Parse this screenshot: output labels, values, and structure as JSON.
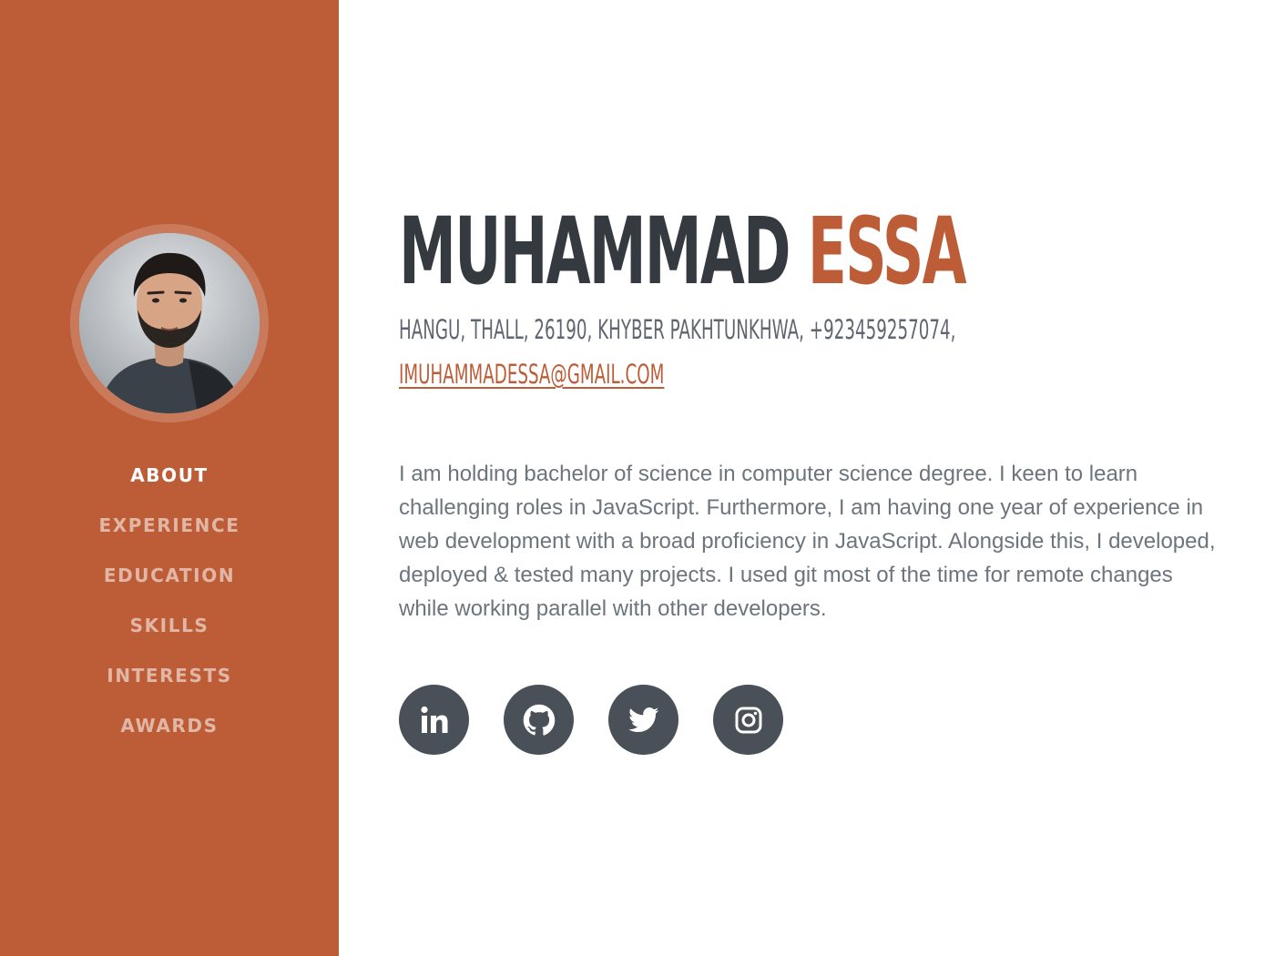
{
  "profile": {
    "first_name": "MUHAMMAD",
    "last_name": "ESSA",
    "contact_line": "HANGU, THALL, 26190, KHYBER PAKHTUNKHWA, +923459257074,",
    "email": "IMUHAMMADESSA@GMAIL.COM",
    "about": "I am holding bachelor of science in computer science degree. I keen to learn challenging roles in JavaScript. Furthermore, I am having one year of experience in web development with a broad proficiency in JavaScript. Alongside this, I developed, deployed & tested many projects. I used git most of the time for remote changes while working parallel with other developers."
  },
  "nav": {
    "items": [
      {
        "label": "ABOUT",
        "active": true
      },
      {
        "label": "EXPERIENCE",
        "active": false
      },
      {
        "label": "EDUCATION",
        "active": false
      },
      {
        "label": "SKILLS",
        "active": false
      },
      {
        "label": "INTERESTS",
        "active": false
      },
      {
        "label": "AWARDS",
        "active": false
      }
    ]
  },
  "social": {
    "icons": [
      "linkedin-icon",
      "github-icon",
      "twitter-icon",
      "instagram-icon"
    ]
  },
  "colors": {
    "primary": "#bd5d38",
    "heading": "#343a40",
    "text": "#6c757d",
    "icon_bg": "#495057"
  }
}
